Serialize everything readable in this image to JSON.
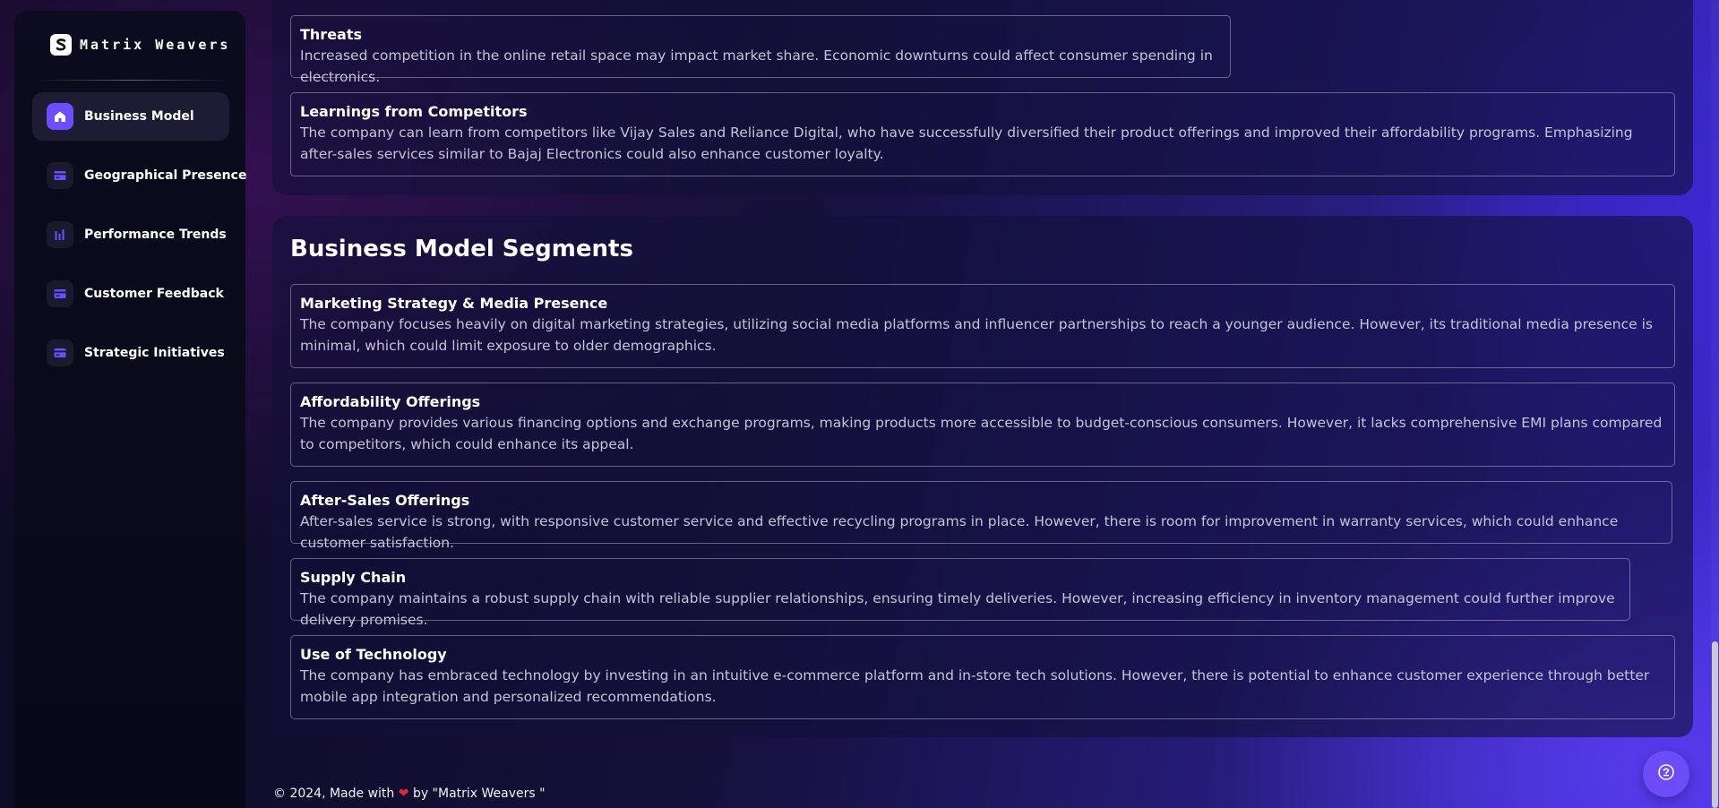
{
  "brand": {
    "name": "Matrix Weavers",
    "icon": "brand-s-logo"
  },
  "sidebar": {
    "items": [
      {
        "label": "Business Model",
        "icon": "home-icon",
        "active": true
      },
      {
        "label": "Geographical Presence",
        "icon": "card-icon",
        "active": false
      },
      {
        "label": "Performance Trends",
        "icon": "bar-chart-icon",
        "active": false
      },
      {
        "label": "Customer Feedback",
        "icon": "card-icon",
        "active": false
      },
      {
        "label": "Strategic Initiatives",
        "icon": "card-icon",
        "active": false
      }
    ]
  },
  "swot": {
    "threats": {
      "title": "Threats",
      "text": "Increased competition in the online retail space may impact market share. Economic downturns could affect consumer spending in electronics."
    },
    "learnings": {
      "title": "Learnings from Competitors",
      "text": "The company can learn from competitors like Vijay Sales and Reliance Digital, who have successfully diversified their product offerings and improved their affordability programs. Emphasizing after-sales services similar to Bajaj Electronics could also enhance customer loyalty."
    }
  },
  "segments": {
    "title": "Business Model Segments",
    "items": [
      {
        "title": "Marketing Strategy & Media Presence",
        "text": "The company focuses heavily on digital marketing strategies, utilizing social media platforms and influencer partnerships to reach a younger audience. However, its traditional media presence is minimal, which could limit exposure to older demographics."
      },
      {
        "title": "Affordability Offerings",
        "text": "The company provides various financing options and exchange programs, making products more accessible to budget-conscious consumers. However, it lacks comprehensive EMI plans compared to competitors, which could enhance its appeal."
      },
      {
        "title": "After-Sales Offerings",
        "text": "After-sales service is strong, with responsive customer service and effective recycling programs in place. However, there is room for improvement in warranty services, which could enhance customer satisfaction."
      },
      {
        "title": "Supply Chain",
        "text": "The company maintains a robust supply chain with reliable supplier relationships, ensuring timely deliveries. However, increasing efficiency in inventory management could further improve delivery promises."
      },
      {
        "title": "Use of Technology",
        "text": "The company has embraced technology by investing in an intuitive e-commerce platform and in-store tech solutions. However, there is potential to enhance customer experience through better mobile app integration and personalized recommendations."
      }
    ]
  },
  "footer": {
    "prefix": "© 2024, Made with",
    "suffix": "by \"Matrix Weavers \""
  },
  "colors": {
    "accent": "#6d4dfc",
    "heart": "#e6243b"
  }
}
